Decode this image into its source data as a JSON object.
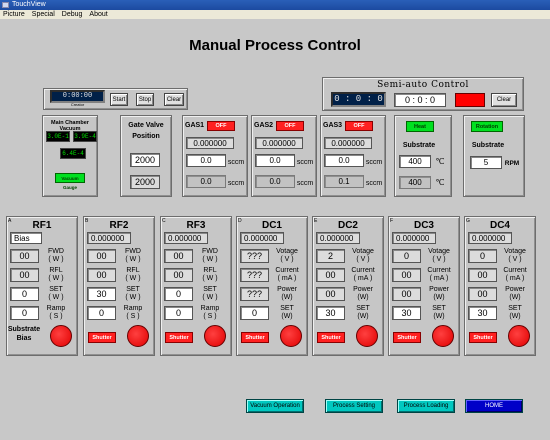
{
  "window": {
    "title": "TouchView"
  },
  "menu": [
    "Picture",
    "Special",
    "Debug",
    "About"
  ],
  "page_title": "Manual Process Control",
  "timer": {
    "value": "0:00:00",
    "sublabel": "Creator",
    "start": "Start",
    "stop": "Stop",
    "clear": "Clear"
  },
  "semi_auto": {
    "title": "Semi-auto Control",
    "elapsed": "0 : 0 : 0",
    "setpoint": "0 : 0 : 0",
    "clear": "Clear"
  },
  "vacuum": {
    "title": "Main Chamber Vacuum",
    "gauge1": "3.0E-1",
    "gauge2": "3.9E-4",
    "gauge3": "6.4E-4",
    "button": "Vacuum Gauge"
  },
  "gate_valve": {
    "title1": "Gate Valve",
    "title2": "Position",
    "set": "2000",
    "actual": "2000"
  },
  "gases": [
    {
      "name": "GAS1",
      "state": "OFF",
      "reading": "0.000000",
      "set": "0.0",
      "actual": "0.0",
      "unit": "sccm"
    },
    {
      "name": "GAS2",
      "state": "OFF",
      "reading": "0.000000",
      "set": "0.0",
      "actual": "0.0",
      "unit": "sccm"
    },
    {
      "name": "GAS3",
      "state": "OFF",
      "reading": "0.000000",
      "set": "0.0",
      "actual": "0.1",
      "unit": "sccm"
    }
  ],
  "heat": {
    "button": "Heat",
    "label": "Substrate",
    "set": "400",
    "actual": "400",
    "unit": "℃"
  },
  "rotation": {
    "button": "Rotation",
    "label": "Substrate",
    "set": "5",
    "unit": "RPM"
  },
  "rf_panels": [
    {
      "letter": "A",
      "name": "RF1",
      "reading": "Bias",
      "fwd": "00",
      "rfl": "00",
      "set": "0",
      "ramp": "0",
      "bottom_label": "Substrate Bias"
    },
    {
      "letter": "B",
      "name": "RF2",
      "reading": "0.000000",
      "fwd": "00",
      "rfl": "00",
      "set": "30",
      "ramp": "0",
      "shutter": "Shutter"
    },
    {
      "letter": "C",
      "name": "RF3",
      "reading": "0.000000",
      "fwd": "00",
      "rfl": "00",
      "set": "0",
      "ramp": "0",
      "shutter": "Shutter"
    }
  ],
  "rf_labels": {
    "fwd": "FWD",
    "rfl": "RFL",
    "set": "SET",
    "ramp": "Ramp",
    "unit_w": "( W )",
    "unit_s": "( S )"
  },
  "dc_panels": [
    {
      "letter": "D",
      "name": "DC1",
      "reading": "0.000000",
      "voltage": "???",
      "current": "???",
      "power": "???",
      "set": "0",
      "shutter": "Shutter"
    },
    {
      "letter": "E",
      "name": "DC2",
      "reading": "0.000000",
      "voltage": "2",
      "current": "00",
      "power": "00",
      "set": "30",
      "shutter": "Shutter"
    },
    {
      "letter": "F",
      "name": "DC3",
      "reading": "0.000000",
      "voltage": "0",
      "current": "00",
      "power": "00",
      "set": "30",
      "shutter": "Shutter"
    },
    {
      "letter": "G",
      "name": "DC4",
      "reading": "0.000000",
      "voltage": "0",
      "current": "00",
      "power": "00",
      "set": "30",
      "shutter": "Shutter"
    }
  ],
  "dc_labels": {
    "voltage": "Votage",
    "voltage_unit": "( V )",
    "current": "Current",
    "current_unit": "( mA )",
    "power": "Power",
    "power_unit": "(W)",
    "set": "SET",
    "set_unit": "(W)"
  },
  "nav": [
    "Vacuum Operation",
    "Process Setting",
    "Process Loading",
    "HOME"
  ],
  "colors": {
    "background": "#c8c8c8",
    "alarm_red": "#ff0000",
    "ok_green": "#00e020",
    "nav_cyan": "#00c8c0",
    "nav_selected": "#0000c8"
  }
}
